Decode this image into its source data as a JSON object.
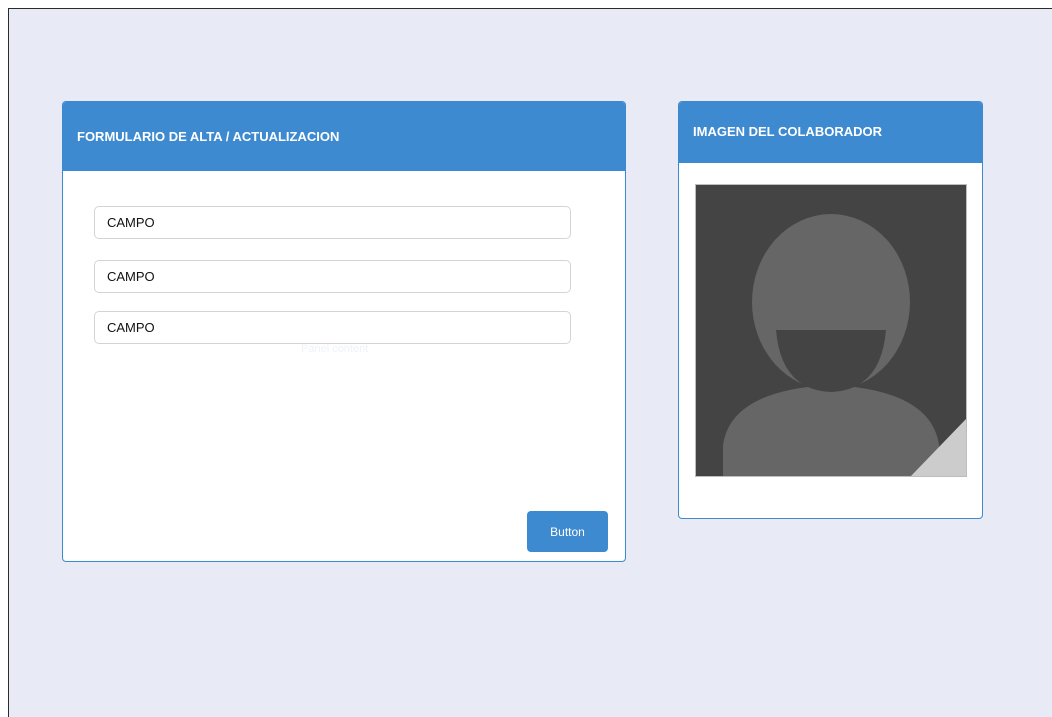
{
  "form_panel": {
    "title": "FORMULARIO DE ALTA / ACTUALIZACION",
    "fields": [
      {
        "placeholder": "CAMPO"
      },
      {
        "placeholder": "CAMPO"
      },
      {
        "placeholder": "CAMPO"
      }
    ],
    "hint": "Panel content",
    "button_label": "Button"
  },
  "image_panel": {
    "title": "IMAGEN DEL COLABORADOR",
    "image_icon": "user-avatar-placeholder-icon"
  },
  "colors": {
    "accent": "#3d8ad0",
    "background": "#e8eaf5",
    "avatar_bg": "#444444",
    "avatar_figure": "#666666"
  }
}
